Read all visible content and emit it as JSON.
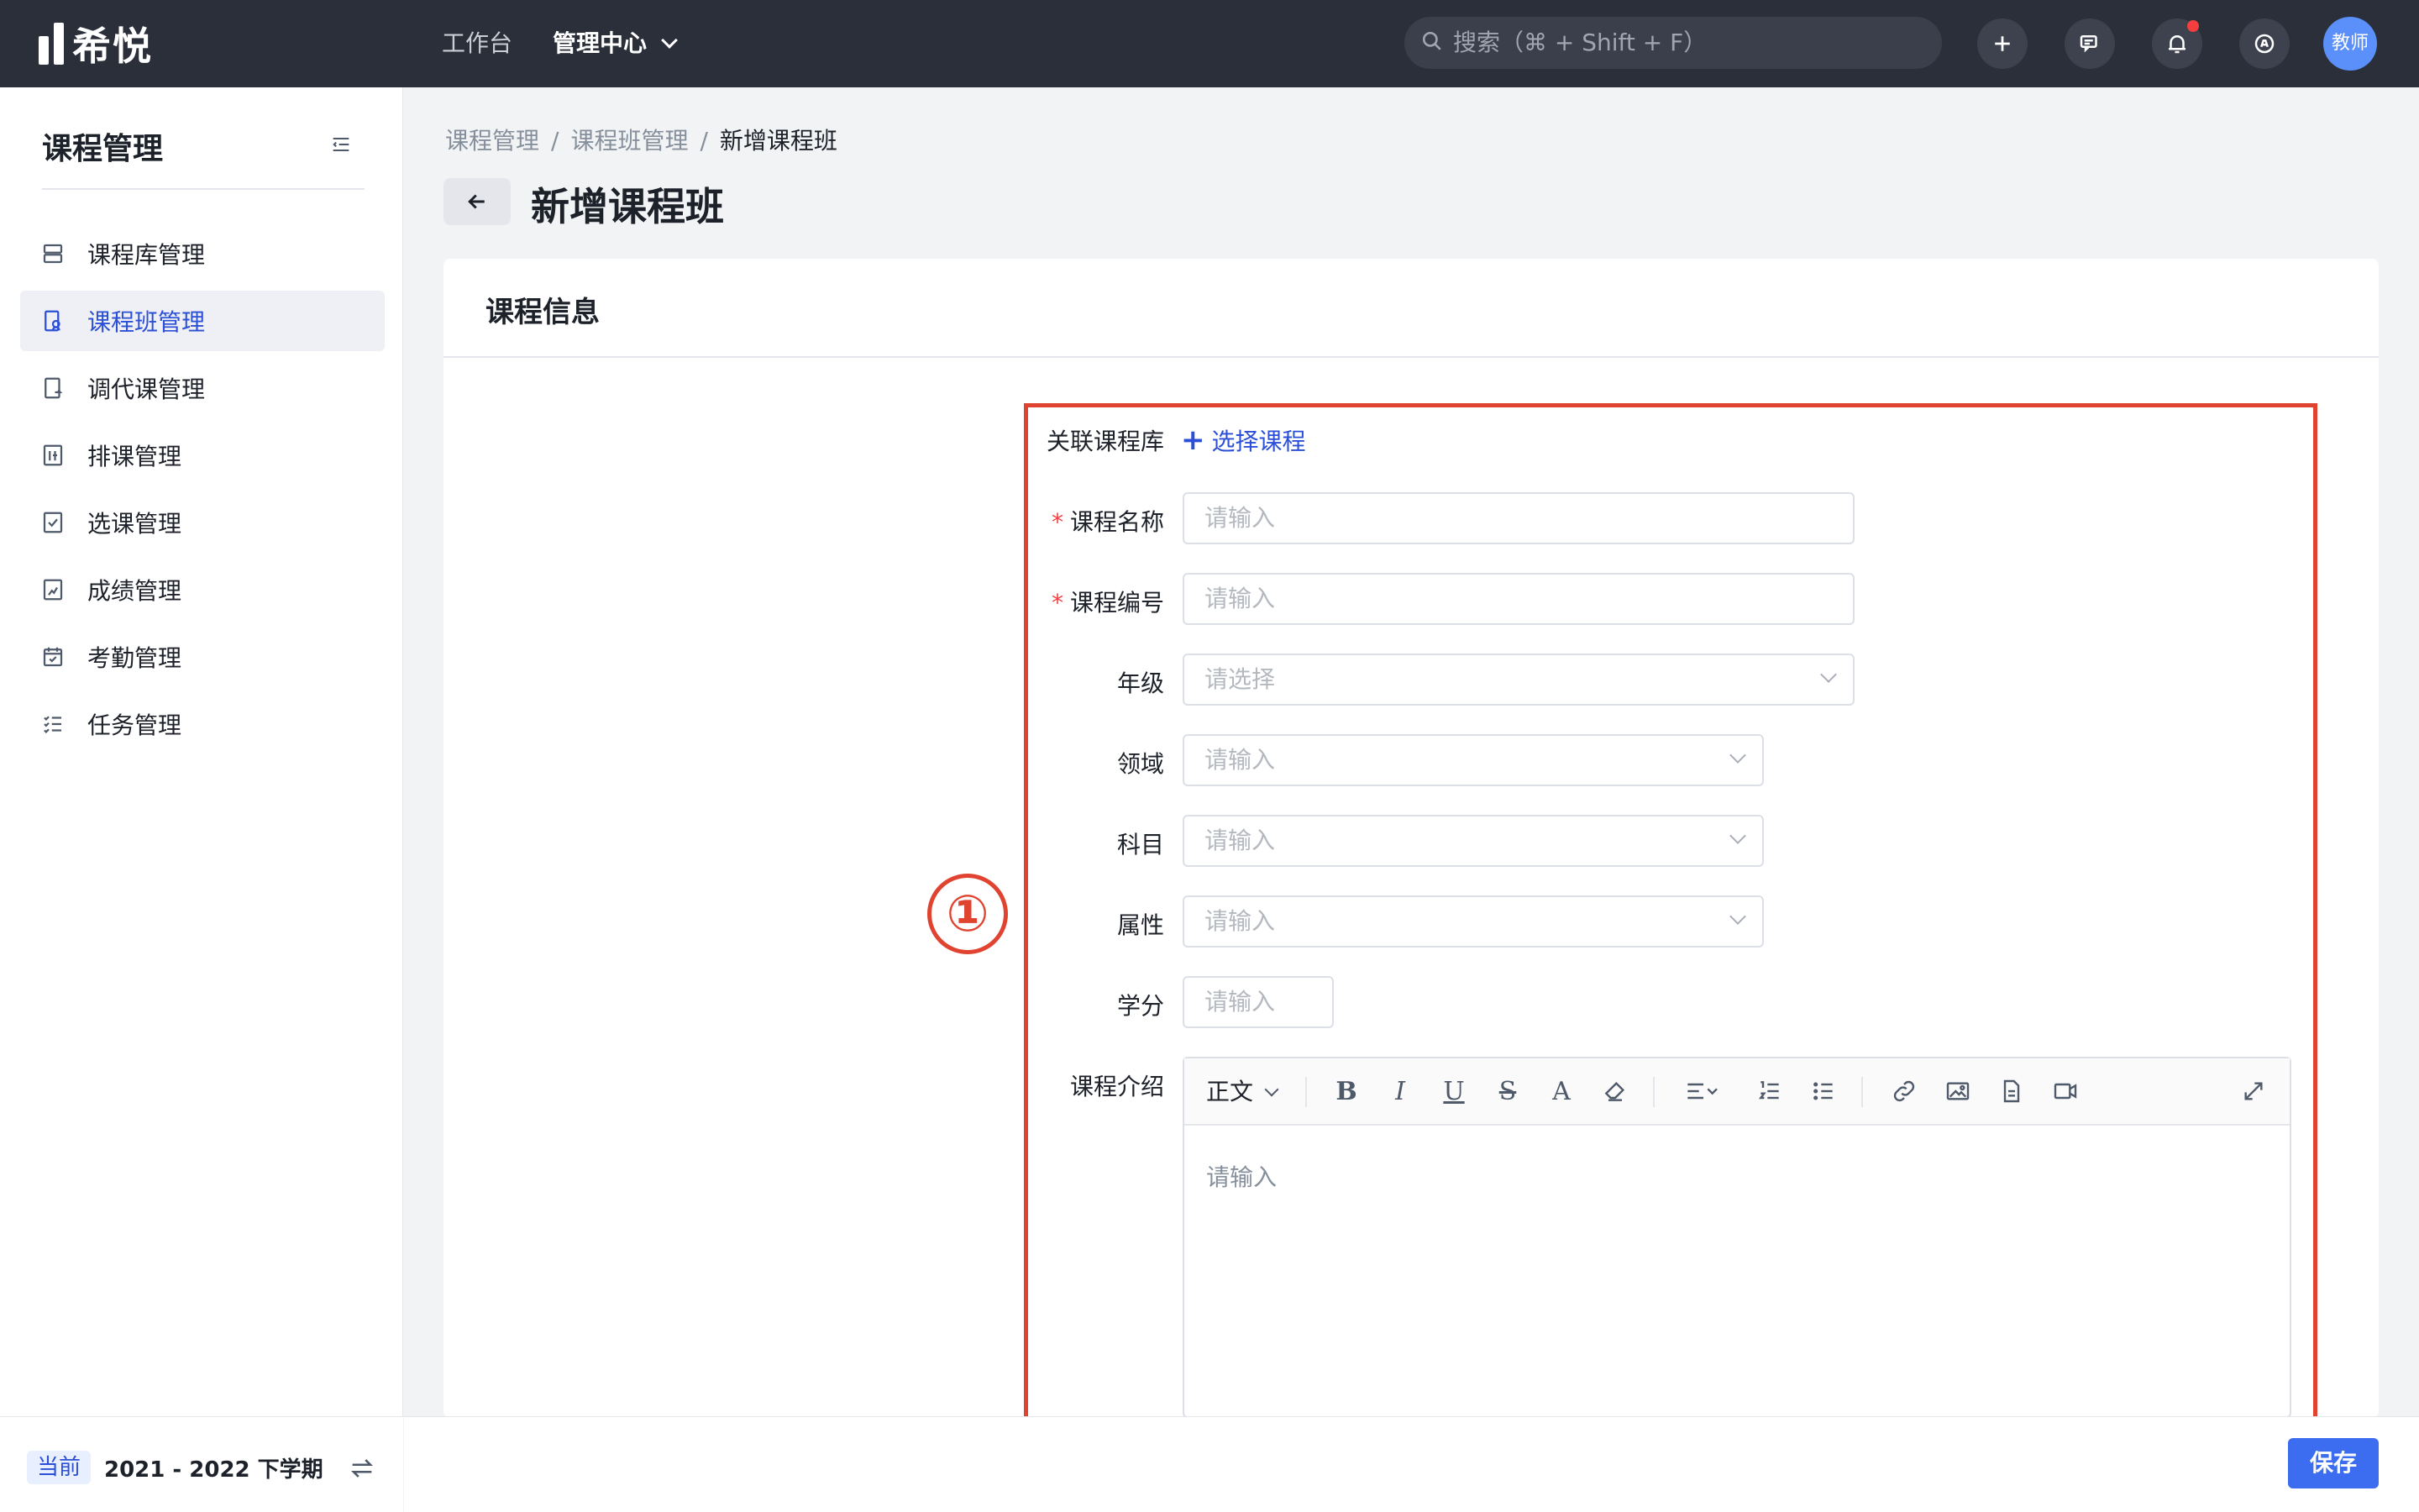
{
  "app": {
    "logo_text": "希悦"
  },
  "topnav": {
    "workbench": "工作台",
    "management_center": "管理中心",
    "search_placeholder": "搜索（⌘ + Shift + F）",
    "avatar_text": "教师"
  },
  "sidebar": {
    "title": "课程管理",
    "items": [
      {
        "label": "课程库管理",
        "icon": "list-icon"
      },
      {
        "label": "课程班管理",
        "icon": "class-icon",
        "active": true
      },
      {
        "label": "调代课管理",
        "icon": "swap-doc-icon"
      },
      {
        "label": "排课管理",
        "icon": "schedule-icon"
      },
      {
        "label": "选课管理",
        "icon": "checkbox-icon"
      },
      {
        "label": "成绩管理",
        "icon": "grade-icon"
      },
      {
        "label": "考勤管理",
        "icon": "calendar-icon"
      },
      {
        "label": "任务管理",
        "icon": "task-icon"
      }
    ],
    "term_badge": "当前",
    "term_text": "2021 - 2022 下学期"
  },
  "breadcrumb": [
    "课程管理",
    "课程班管理",
    "新增课程班"
  ],
  "page": {
    "title": "新增课程班"
  },
  "card": {
    "title": "课程信息"
  },
  "annotation": {
    "marker": "①",
    "color": "#e0432f"
  },
  "form": {
    "link_label": "关联课程库",
    "select_course": "选择课程",
    "fields": [
      {
        "label": "课程名称",
        "required": true,
        "placeholder": "请输入"
      },
      {
        "label": "课程编号",
        "required": true,
        "placeholder": "请输入"
      },
      {
        "label": "年级",
        "placeholder": "请选择"
      },
      {
        "label": "领域",
        "placeholder": "请输入"
      },
      {
        "label": "科目",
        "placeholder": "请输入"
      },
      {
        "label": "属性",
        "placeholder": "请输入"
      },
      {
        "label": "学分",
        "placeholder": "请输入"
      }
    ],
    "intro_label": "课程介绍",
    "editor_style": "正文",
    "editor_placeholder": "请输入"
  },
  "footer": {
    "save": "保存"
  },
  "colors": {
    "accent": "#2b4fd6",
    "topbar": "#2b2f3a",
    "primary_button": "#3c6df0"
  }
}
